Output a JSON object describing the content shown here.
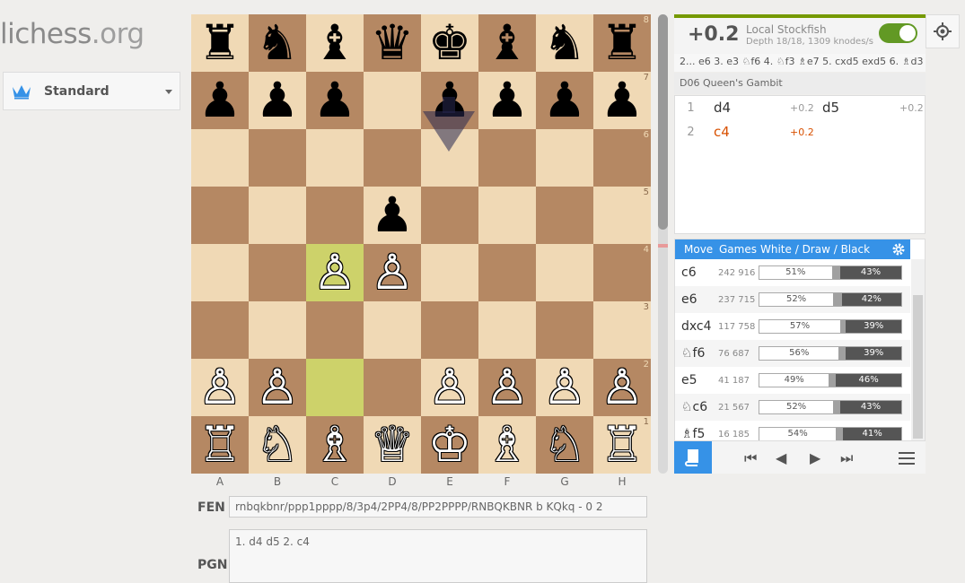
{
  "site": {
    "name": "lichess",
    "tld": ".org"
  },
  "variant": {
    "label": "Standard",
    "icon": "crown-icon"
  },
  "board": {
    "files": [
      "A",
      "B",
      "C",
      "D",
      "E",
      "F",
      "G",
      "H"
    ],
    "ranks": [
      "8",
      "7",
      "6",
      "5",
      "4",
      "3",
      "2",
      "1"
    ],
    "highlight_squares": [
      "c2",
      "c4"
    ],
    "arrow": {
      "from": "e7",
      "to": "e6"
    },
    "position": [
      [
        "♜",
        "♞",
        "♝",
        "♛",
        "♚",
        "♝",
        "♞",
        "♜"
      ],
      [
        "♟",
        "♟",
        "♟",
        "",
        "♟",
        "♟",
        "♟",
        "♟"
      ],
      [
        "",
        "",
        "",
        "",
        "",
        "",
        "",
        ""
      ],
      [
        "",
        "",
        "",
        "♟",
        "",
        "",
        "",
        ""
      ],
      [
        "",
        "",
        "♙",
        "♙",
        "",
        "",
        "",
        ""
      ],
      [
        "",
        "",
        "",
        "",
        "",
        "",
        "",
        ""
      ],
      [
        "♙",
        "♙",
        "",
        "",
        "♙",
        "♙",
        "♙",
        "♙"
      ],
      [
        "♖",
        "♘",
        "♗",
        "♕",
        "♔",
        "♗",
        "♘",
        "♖"
      ]
    ]
  },
  "fen": {
    "label": "FEN",
    "value": "rnbqkbnr/ppp1pppp/8/3p4/2PP4/8/PP2PPPP/RNBQKBNR b KQkq - 0 2"
  },
  "pgn": {
    "label": "PGN",
    "value": "1. d4 d5 2. c4"
  },
  "engine": {
    "eval": "+0.2",
    "name": "Local Stockfish",
    "depth": "Depth 18/18, 1309 knodes/s",
    "enabled": true,
    "pv": "2... e6 3. e3 ♘f6 4. ♘f3 ♗e7 5. cxd5 exd5 6. ♗d3 ..."
  },
  "opening": "D06 Queen's Gambit",
  "moves": [
    {
      "num": "1",
      "white": "d4",
      "white_eval": "+0.2",
      "black": "d5",
      "black_eval": "+0.2"
    },
    {
      "num": "2",
      "white": "c4",
      "white_eval": "+0.2",
      "black": "",
      "black_eval": ""
    }
  ],
  "explorer": {
    "headers": {
      "move": "Move",
      "games": "Games",
      "wdb": "White / Draw / Black"
    },
    "rows": [
      {
        "move": "c6",
        "games": "242 916",
        "white": 51,
        "black": 43,
        "white_label": "51%",
        "black_label": "43%"
      },
      {
        "move": "e6",
        "games": "237 715",
        "white": 52,
        "black": 42,
        "white_label": "52%",
        "black_label": "42%"
      },
      {
        "move": "dxc4",
        "games": "117 758",
        "white": 57,
        "black": 39,
        "white_label": "57%",
        "black_label": "39%"
      },
      {
        "move": "♘f6",
        "games": "76 687",
        "white": 56,
        "black": 39,
        "white_label": "56%",
        "black_label": "39%"
      },
      {
        "move": "e5",
        "games": "41 187",
        "white": 49,
        "black": 46,
        "white_label": "49%",
        "black_label": "46%"
      },
      {
        "move": "♘c6",
        "games": "21 567",
        "white": 52,
        "black": 43,
        "white_label": "52%",
        "black_label": "43%"
      },
      {
        "move": "♗f5",
        "games": "16 185",
        "white": 54,
        "black": 41,
        "white_label": "54%",
        "black_label": "41%"
      }
    ]
  },
  "controls": {
    "first": "⏮",
    "prev": "◀",
    "next": "▶",
    "last": "⏭"
  },
  "colors": {
    "accent": "#3692e7",
    "engine_on": "#629924",
    "current_move": "#d85000"
  }
}
